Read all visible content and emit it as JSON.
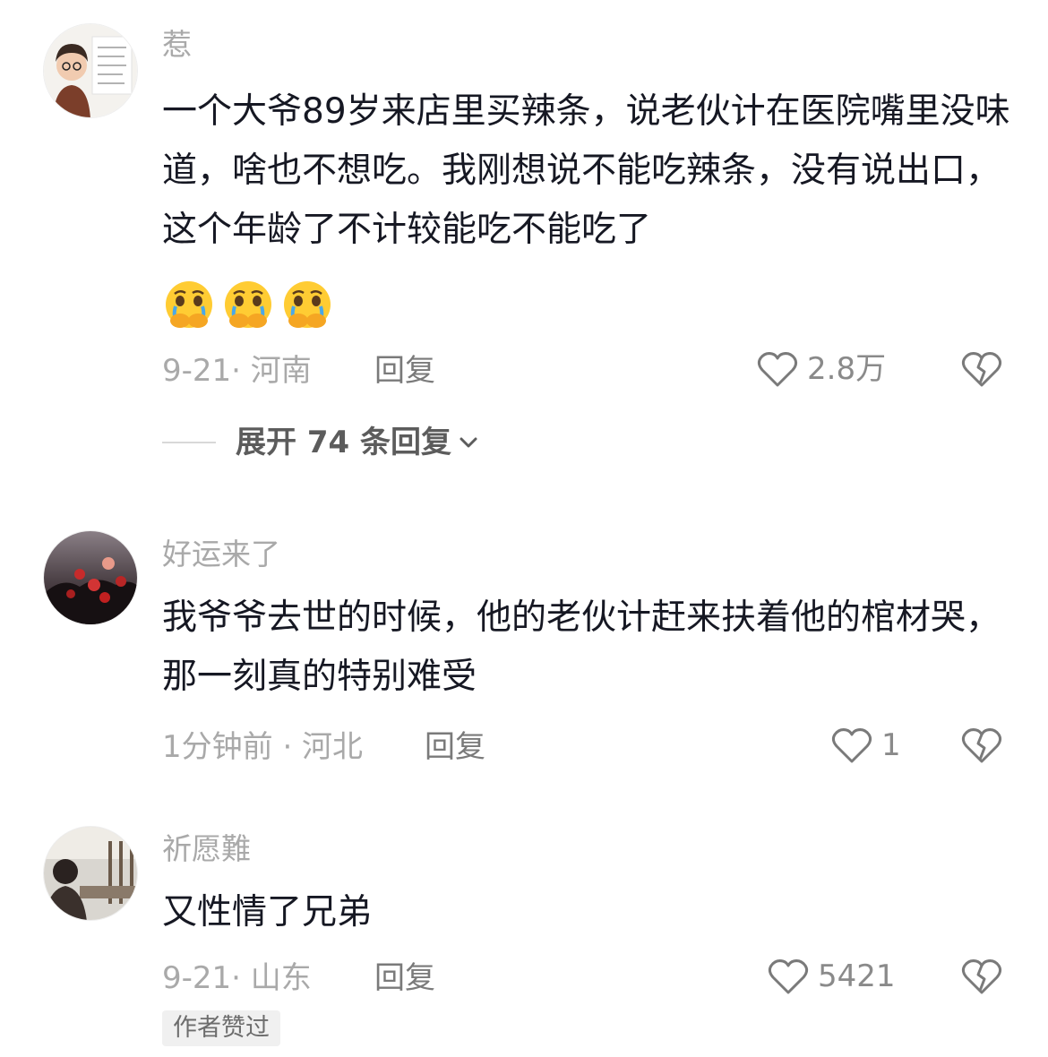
{
  "comments": [
    {
      "username": "惹",
      "content": "一个大爷89岁来店里买辣条，说老伙计在医院嘴里没味道，啥也不想吃。我刚想说不能吃辣条，没有说出口，这个年龄了不计较能吃不能吃了",
      "emojis": [
        "crying-covering-mouth-emoji",
        "crying-covering-mouth-emoji",
        "crying-covering-mouth-emoji"
      ],
      "meta": "9-21· 河南",
      "reply_label": "回复",
      "likes": "2.8万",
      "expand_label": "展开 74 条回复"
    },
    {
      "username": "好运来了",
      "content": "我爷爷去世的时候，他的老伙计赶来扶着他的棺材哭，那一刻真的特别难受",
      "meta": "1分钟前 · 河北",
      "reply_label": "回复",
      "likes": "1"
    },
    {
      "username": "祈愿難",
      "content": "又性情了兄弟",
      "meta": "9-21· 山东",
      "reply_label": "回复",
      "likes": "5421",
      "badge": "作者赞过"
    }
  ],
  "icons": {
    "like": "heart-outline-icon",
    "dislike": "broken-heart-icon",
    "expand": "chevron-down-icon"
  },
  "colors": {
    "text": "#161823",
    "secondary": "#a9a9a9",
    "badge_bg": "#f0f0f0"
  }
}
